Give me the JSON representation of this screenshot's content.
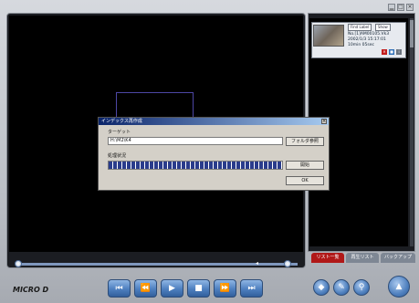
{
  "window_controls": [
    {
      "name": "minimize-button",
      "glyph": "▁"
    },
    {
      "name": "maximize-button",
      "glyph": "□"
    },
    {
      "name": "close-button",
      "glyph": "×"
    }
  ],
  "recording_item": {
    "btn_left": "Find Label",
    "btn_right": "Show",
    "line1": "No.[1]AM00105.Vk3",
    "line2": "2002/1/3 15:17:01",
    "line3": "10min 05sec"
  },
  "tabs": {
    "list": "リスト一覧",
    "playlist": "再生リスト",
    "backup": "バックアップ"
  },
  "dialog": {
    "title": "インデックス再作成",
    "target_label": "ターゲット",
    "target_value": "H:\\M2\\K4",
    "browse_label": "フォルダ参照",
    "progress_label": "処理状況",
    "start_label": "開始",
    "ok_label": "OK",
    "progress_value": 1.0
  },
  "timeline": {
    "left_marker": "▸",
    "right_marker": "◂"
  },
  "transport": {
    "first_icon": "⏮",
    "rewind_icon": "⏪",
    "play_icon": "▶",
    "stop_icon": "■",
    "forward_icon": "⏩",
    "last_icon": "⏭"
  },
  "round_buttons": {
    "nav_icon": "◆",
    "tool_icon": "✎",
    "search_icon": "⚲",
    "eject_icon": "▲"
  },
  "brand": {
    "logo_text": "MICRO D"
  },
  "colors": {
    "accent": "#4d7fbf",
    "tab_active": "#b01818",
    "tab_inactive": "#7e8794"
  }
}
